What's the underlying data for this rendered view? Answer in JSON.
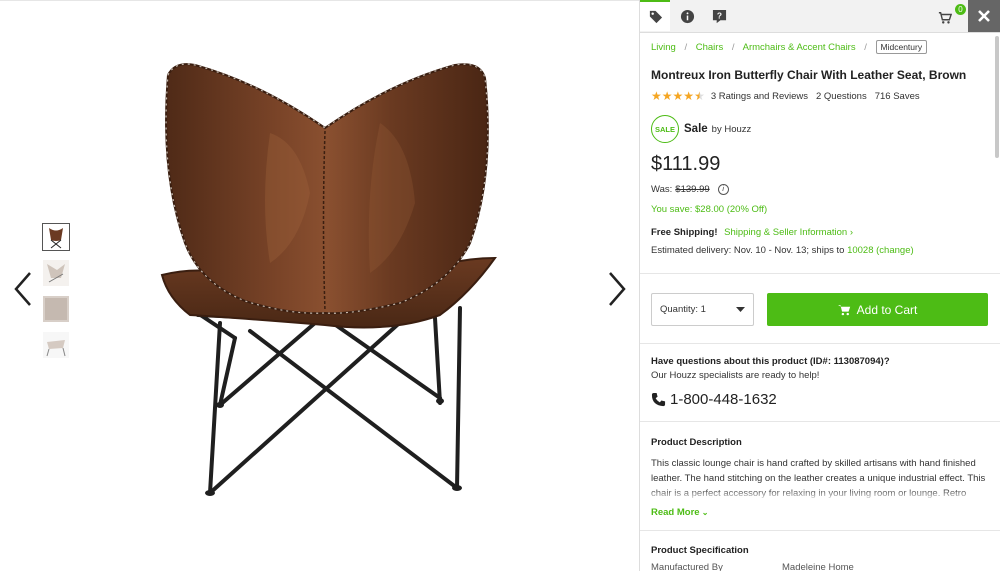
{
  "gallery": {
    "prev_label": "Previous image",
    "next_label": "Next image",
    "thumbnails": [
      "thumb-1",
      "thumb-2",
      "thumb-3",
      "thumb-4"
    ]
  },
  "topbar": {
    "tabs": [
      "tag-icon",
      "info-icon",
      "question-icon"
    ],
    "cart_count": "0"
  },
  "breadcrumb": {
    "items": [
      "Living",
      "Chairs",
      "Armchairs & Accent Chairs"
    ],
    "tag": "Midcentury"
  },
  "product": {
    "title": "Montreux Iron Butterfly Chair With Leather Seat, Brown",
    "rating_value": 4.5,
    "ratings_text": "3 Ratings and Reviews",
    "questions_text": "2 Questions",
    "saves_text": "716 Saves",
    "sale_badge": "SALE",
    "sale_label": "Sale",
    "sold_by": "by Houzz",
    "price": "$111.99",
    "was_label": "Was:",
    "was_price": "$139.99",
    "you_save": "You save: $28.00 (20% Off)",
    "free_shipping": "Free Shipping!",
    "shipping_link": "Shipping & Seller Information",
    "delivery_text": "Estimated delivery: Nov. 10 - Nov. 13; ships to",
    "zip": "10028",
    "change": "(change)"
  },
  "buy": {
    "quantity_label": "Quantity: 1",
    "add_to_cart": "Add to Cart"
  },
  "questions": {
    "heading": "Have questions about this product (ID#: 113087094)?",
    "sub": "Our Houzz specialists are ready to help!",
    "phone": "1-800-448-1632"
  },
  "description": {
    "heading": "Product Description",
    "text": "This classic lounge chair is hand crafted by skilled artisans with hand finished leather. The hand stitching on the leather creates a unique industrial effect. This chair is a perfect accessory for relaxing in your living room or lounge. Retro",
    "read_more": "Read More"
  },
  "specification": {
    "heading": "Product Specification",
    "rows": [
      {
        "key": "Manufactured By",
        "value": "Madeleine Home"
      }
    ]
  },
  "colors": {
    "accent": "#4dbc15",
    "leather": "#6b3a22",
    "frame": "#1f1f1f"
  }
}
